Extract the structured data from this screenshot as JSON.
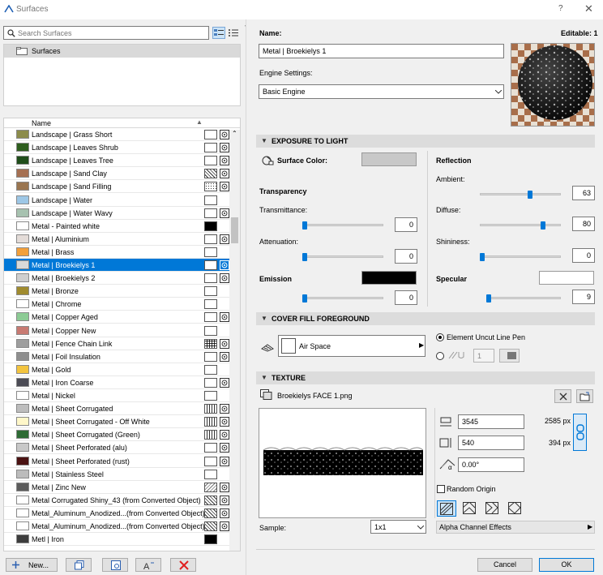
{
  "window": {
    "title": "Surfaces",
    "help": "?",
    "close": "✕"
  },
  "search": {
    "placeholder": "Search Surfaces"
  },
  "tree": {
    "root_label": "Surfaces"
  },
  "list": {
    "column_name": "Name",
    "items": [
      {
        "name": "Landscape | Grass Short",
        "color": "#8c8c4b",
        "fill": "empty",
        "textured": true
      },
      {
        "name": "Landscape | Leaves Shrub",
        "color": "#2e5e1e",
        "fill": "empty",
        "textured": true
      },
      {
        "name": "Landscape | Leaves Tree",
        "color": "#1f4d1a",
        "fill": "empty",
        "textured": true
      },
      {
        "name": "Landscape | Sand Clay",
        "color": "#a57052",
        "fill": "hatch",
        "textured": true
      },
      {
        "name": "Landscape | Sand Filling",
        "color": "#9a7550",
        "fill": "dots",
        "textured": true
      },
      {
        "name": "Landscape | Water",
        "color": "#9dc7e6",
        "fill": "empty",
        "textured": false
      },
      {
        "name": "Landscape | Water Wavy",
        "color": "#a7c2b0",
        "fill": "empty",
        "textured": true
      },
      {
        "name": "Metal - Painted white",
        "color": "#ffffff",
        "fill": "solid",
        "textured": false
      },
      {
        "name": "Metal | Aluminium",
        "color": "#e4dcd8",
        "fill": "empty",
        "textured": true
      },
      {
        "name": "Metal | Brass",
        "color": "#f3a03a",
        "fill": "empty",
        "textured": false
      },
      {
        "name": "Metal | Broekielys 1",
        "color": "#d9d9d9",
        "fill": "empty",
        "textured": true,
        "selected": true
      },
      {
        "name": "Metal | Broekielys 2",
        "color": "#cfcfcf",
        "fill": "empty",
        "textured": true
      },
      {
        "name": "Metal | Bronze",
        "color": "#a08b2e",
        "fill": "empty",
        "textured": false
      },
      {
        "name": "Metal | Chrome",
        "color": "#ffffff",
        "fill": "empty",
        "textured": false
      },
      {
        "name": "Metal | Copper Aged",
        "color": "#8ccb94",
        "fill": "empty",
        "textured": true
      },
      {
        "name": "Metal | Copper New",
        "color": "#c87a72",
        "fill": "empty",
        "textured": false
      },
      {
        "name": "Metal | Fence Chain Link",
        "color": "#9e9e9e",
        "fill": "grid",
        "textured": true
      },
      {
        "name": "Metal | Foil Insulation",
        "color": "#8e8e8e",
        "fill": "empty",
        "textured": true
      },
      {
        "name": "Metal | Gold",
        "color": "#f3c43e",
        "fill": "empty",
        "textured": false
      },
      {
        "name": "Metal | Iron Coarse",
        "color": "#4b4b55",
        "fill": "empty",
        "textured": true
      },
      {
        "name": "Metal | Nickel",
        "color": "#ffffff",
        "fill": "empty",
        "textured": false
      },
      {
        "name": "Metal | Sheet Corrugated",
        "color": "#bdbdbd",
        "fill": "vlines",
        "textured": true
      },
      {
        "name": "Metal | Sheet Corrugated - Off White",
        "color": "#fff7c9",
        "fill": "vlines",
        "textured": true
      },
      {
        "name": "Metal | Sheet Corrugated (Green)",
        "color": "#2e6b34",
        "fill": "vlines",
        "textured": true
      },
      {
        "name": "Metal | Sheet Perforated (alu)",
        "color": "#c8c8c8",
        "fill": "empty",
        "textured": true
      },
      {
        "name": "Metal | Sheet Perforated (rust)",
        "color": "#4a1212",
        "fill": "empty",
        "textured": true
      },
      {
        "name": "Metal | Stainless Steel",
        "color": "#bcbcbc",
        "fill": "empty",
        "textured": false
      },
      {
        "name": "Metal | Zinc New",
        "color": "#5c5c5c",
        "fill": "wave",
        "textured": true
      },
      {
        "name": "Metal Corrugated Shiny_43 (from Converted Object)",
        "color": "#ffffff",
        "fill": "hatch",
        "textured": true
      },
      {
        "name": "Metal_Aluminum_Anodized...(from Converted Object)",
        "color": "#ffffff",
        "fill": "hatch",
        "textured": true
      },
      {
        "name": "Metal_Aluminum_Anodized...(from Converted Object)",
        "color": "#ffffff",
        "fill": "hatch",
        "textured": true
      },
      {
        "name": "Metl | Iron",
        "color": "#3c3c3c",
        "fill": "solid",
        "textured": false
      }
    ]
  },
  "bottom": {
    "new_label": "New..."
  },
  "header": {
    "name_label": "Name:",
    "editable": "Editable: 1",
    "name_value": "Metal | Broekielys 1",
    "engine_label": "Engine Settings:",
    "engine_value": "Basic Engine"
  },
  "exposure": {
    "title": "EXPOSURE TO LIGHT",
    "surface_color_label": "Surface Color:",
    "surface_color": "#c8c8c8",
    "transparency": "Transparency",
    "transmittance": "Transmittance:",
    "transmittance_value": "0",
    "attenuation": "Attenuation:",
    "attenuation_value": "0",
    "emission": "Emission",
    "emission_value": "0",
    "emission_color": "#000000",
    "reflection": "Reflection",
    "ambient": "Ambient:",
    "ambient_value": "63",
    "diffuse": "Diffuse:",
    "diffuse_value": "80",
    "shininess": "Shininess:",
    "shininess_value": "0",
    "specular": "Specular",
    "specular_value": "9",
    "specular_color": "#ffffff"
  },
  "cover": {
    "title": "COVER FILL FOREGROUND",
    "fill_name": "Air Space",
    "option1": "Element Uncut Line Pen",
    "pen_value": "1"
  },
  "texture": {
    "title": "TEXTURE",
    "file": "Broekielys FACE 1.png",
    "width": "3545",
    "height": "540",
    "angle": "0.00°",
    "px_w": "2585 px",
    "px_h": "394 px",
    "random_origin": "Random Origin",
    "sample_label": "Sample:",
    "sample_value": "1x1",
    "alpha": "Alpha Channel Effects"
  },
  "footer": {
    "cancel": "Cancel",
    "ok": "OK"
  },
  "colors": {
    "accent": "#0078d7",
    "section": "#dcdcdc"
  }
}
